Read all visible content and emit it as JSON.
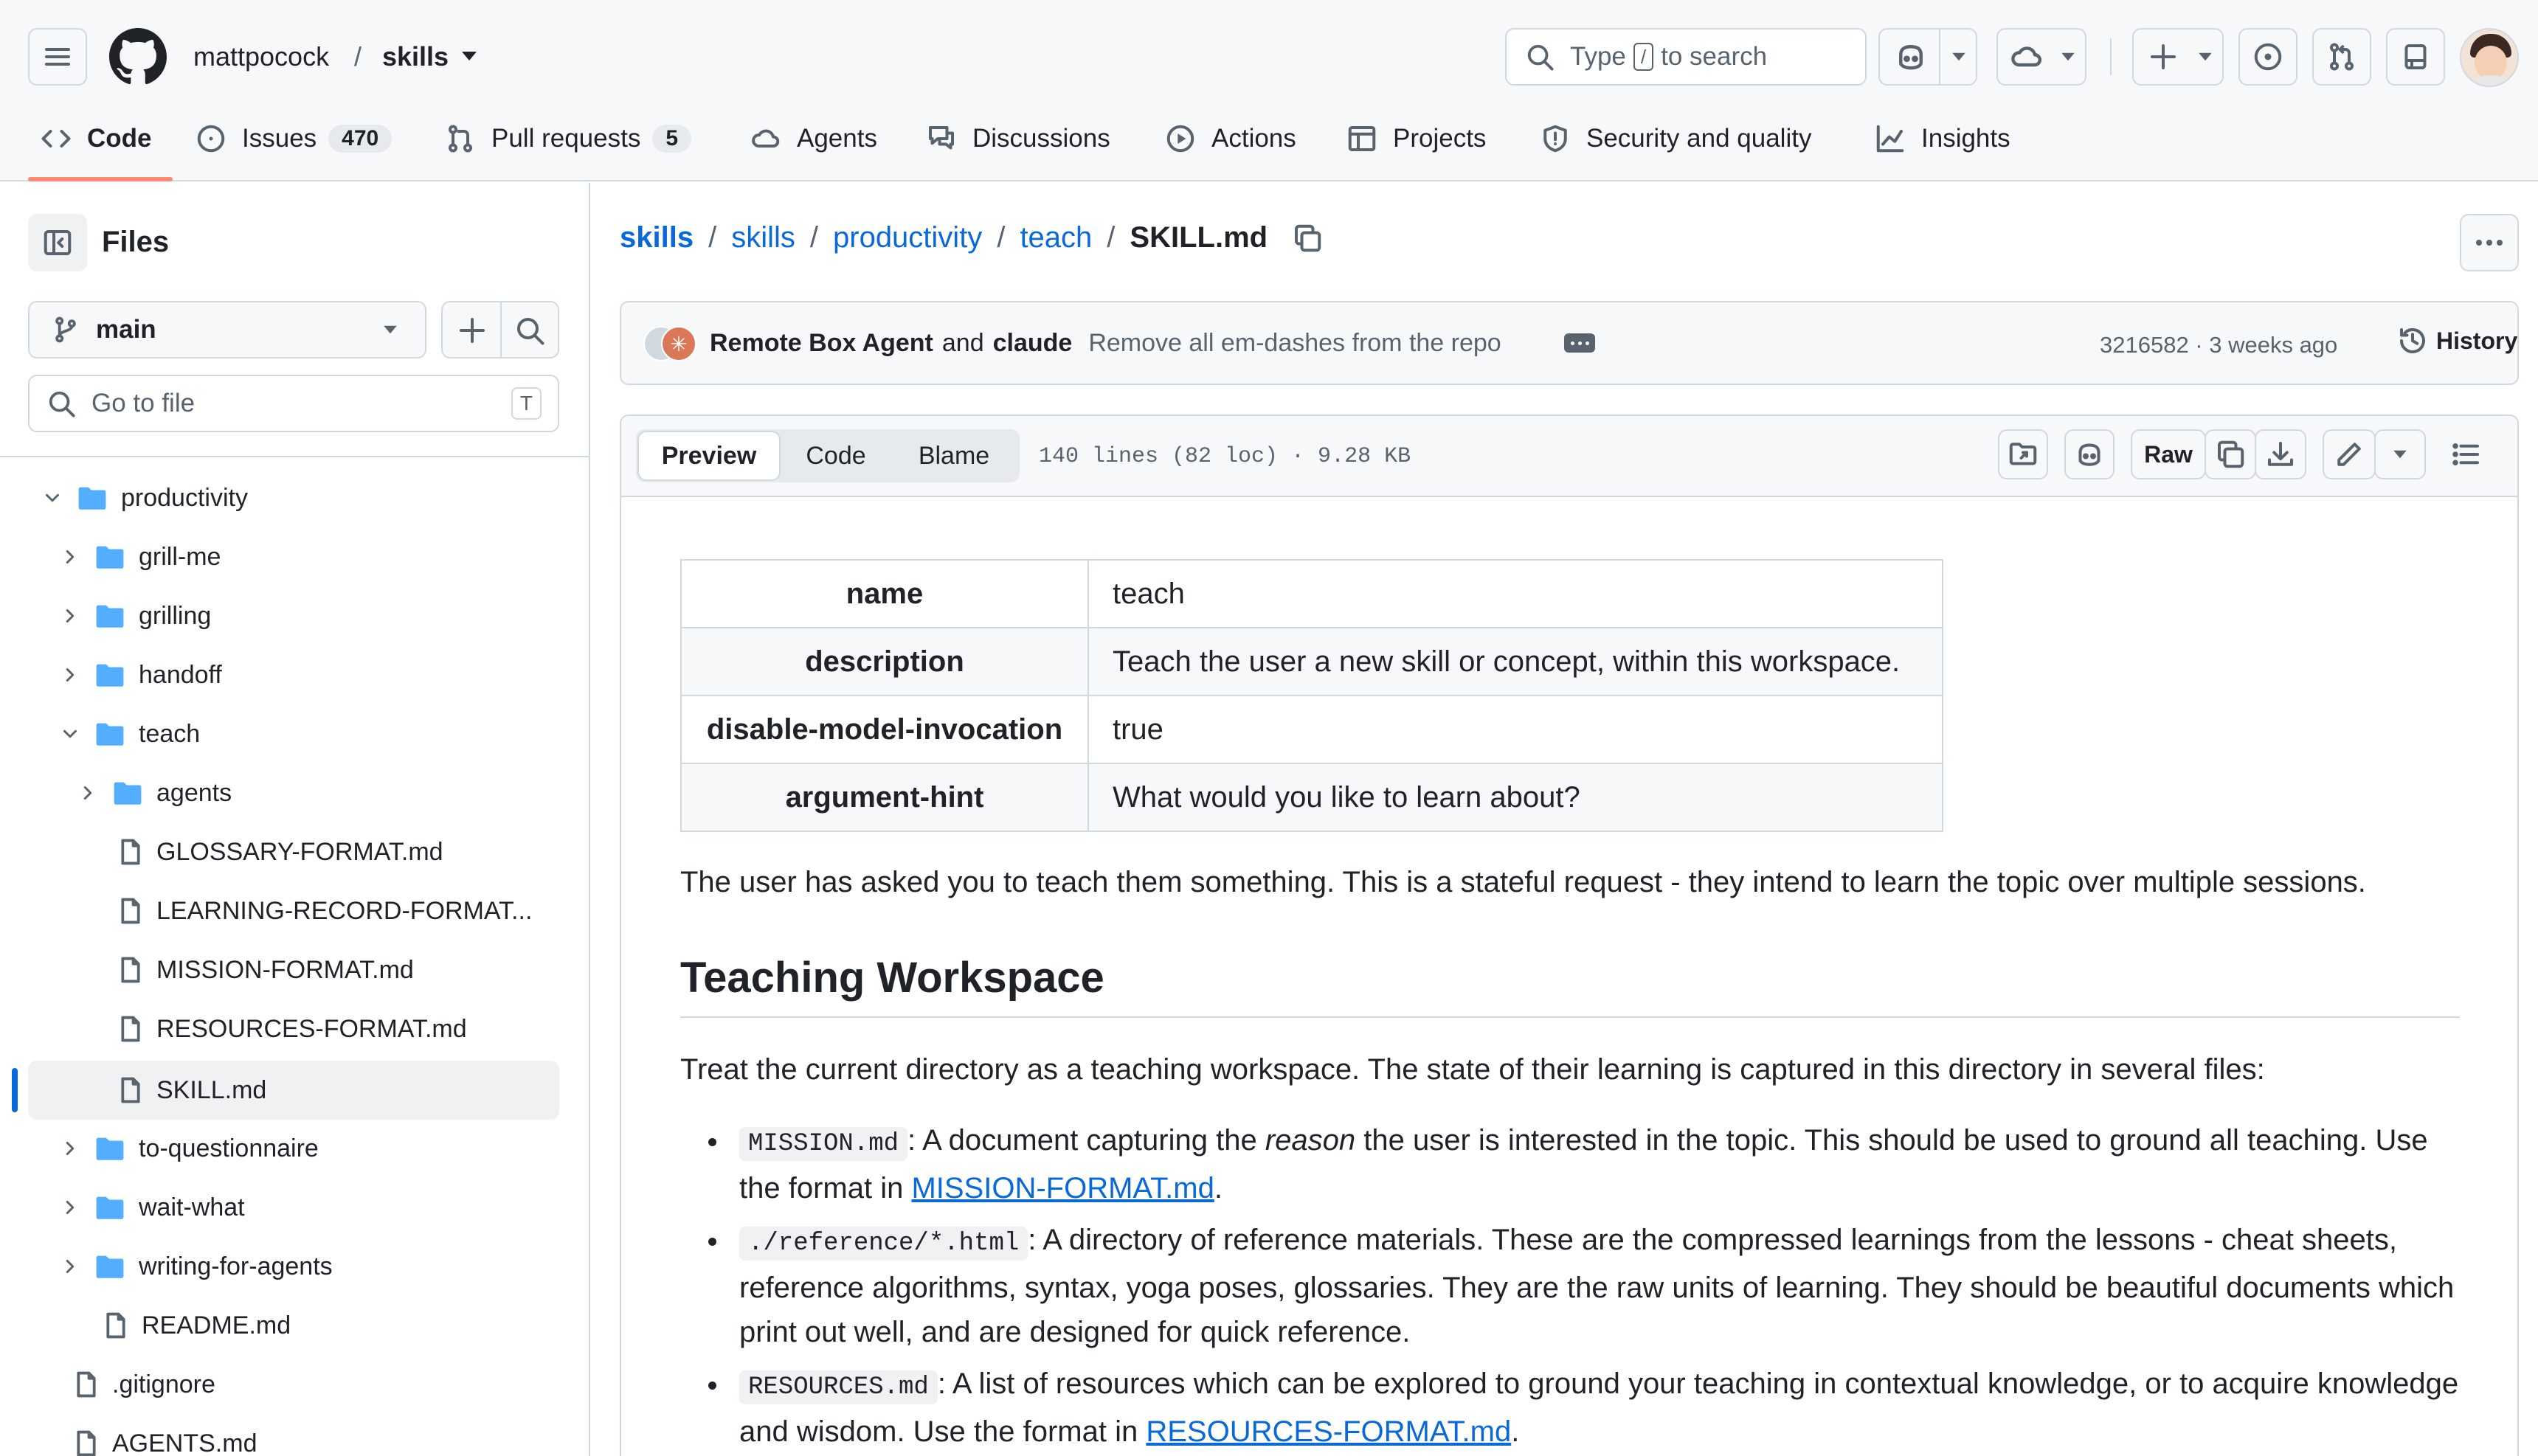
{
  "header": {
    "owner": "mattpocock",
    "separator": "/",
    "repo": "skills",
    "search": {
      "prefix": "Type",
      "key": "/",
      "suffix": "to search"
    },
    "tabs": [
      {
        "label": "Code"
      },
      {
        "label": "Issues",
        "count": "470"
      },
      {
        "label": "Pull requests",
        "count": "5"
      },
      {
        "label": "Agents"
      },
      {
        "label": "Discussions"
      },
      {
        "label": "Actions"
      },
      {
        "label": "Projects"
      },
      {
        "label": "Security and quality"
      },
      {
        "label": "Insights"
      }
    ]
  },
  "sidebar": {
    "title": "Files",
    "branch": "main",
    "goto_placeholder": "Go to file",
    "goto_shortcut": "T",
    "tree": [
      {
        "label": "productivity"
      },
      {
        "label": "grill-me"
      },
      {
        "label": "grilling"
      },
      {
        "label": "handoff"
      },
      {
        "label": "teach"
      },
      {
        "label": "agents"
      },
      {
        "label": "GLOSSARY-FORMAT.md"
      },
      {
        "label": "LEARNING-RECORD-FORMAT..."
      },
      {
        "label": "MISSION-FORMAT.md"
      },
      {
        "label": "RESOURCES-FORMAT.md"
      },
      {
        "label": "SKILL.md"
      },
      {
        "label": "to-questionnaire"
      },
      {
        "label": "wait-what"
      },
      {
        "label": "writing-for-agents"
      },
      {
        "label": "README.md"
      },
      {
        "label": ".gitignore"
      },
      {
        "label": "AGENTS.md"
      }
    ]
  },
  "breadcrumb": {
    "parts": [
      "skills",
      "skills",
      "productivity",
      "teach"
    ],
    "sep": "/",
    "current": "SKILL.md"
  },
  "commit": {
    "author1": "Remote Box Agent",
    "and": "and",
    "author2": "claude",
    "message": "Remove all em-dashes from the repo",
    "meta": "3216582 · 3 weeks ago",
    "history": "History"
  },
  "file_toolbar": {
    "modes": [
      "Preview",
      "Code",
      "Blame"
    ],
    "info": "140 lines (82 loc) · 9.28 KB",
    "raw": "Raw"
  },
  "frontmatter": [
    {
      "key": "name",
      "value": "teach"
    },
    {
      "key": "description",
      "value": "Teach the user a new skill or concept, within this workspace."
    },
    {
      "key": "disable-model-invocation",
      "value": "true"
    },
    {
      "key": "argument-hint",
      "value": "What would you like to learn about?"
    }
  ],
  "content": {
    "intro": "The user has asked you to teach them something. This is a stateful request - they intend to learn the topic over multiple sessions.",
    "h2": "Teaching Workspace",
    "p2": "Treat the current directory as a teaching workspace. The state of their learning is captured in this directory in several files:",
    "b1": {
      "code": "MISSION.md",
      "t1": ": A document capturing the ",
      "em": "reason",
      "t2": " the user is interested in the topic. This should be used to ground all teaching. Use the format in ",
      "link": "MISSION-FORMAT.md",
      "end": "."
    },
    "b2": {
      "code": "./reference/*.html",
      "t1": ": A directory of reference materials. These are the compressed learnings from the lessons - cheat sheets, reference algorithms, syntax, yoga poses, glossaries. They are the raw units of learning. They should be beautiful documents which print out well, and are designed for quick reference."
    },
    "b3": {
      "code": "RESOURCES.md",
      "t1": ": A list of resources which can be explored to ground your teaching in contextual knowledge, or to acquire knowledge and wisdom. Use the format in ",
      "link": "RESOURCES-FORMAT.md",
      "end": "."
    }
  }
}
